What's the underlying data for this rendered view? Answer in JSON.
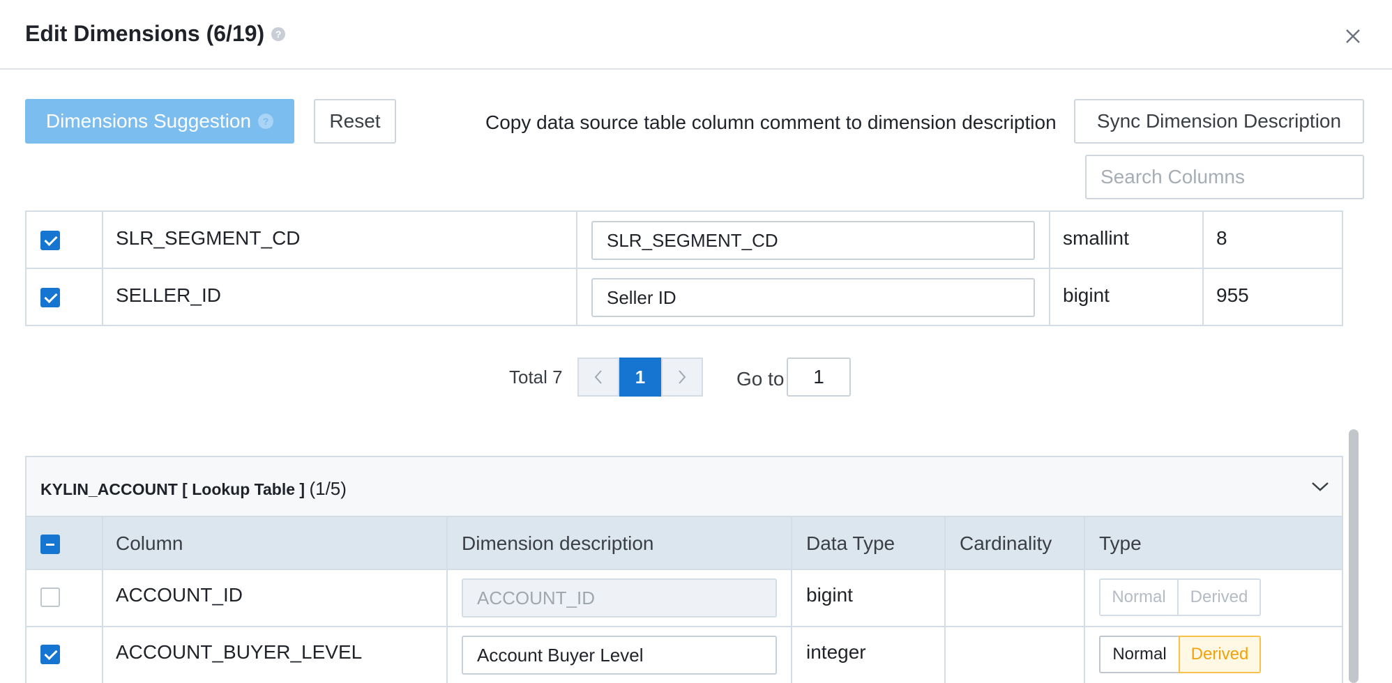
{
  "dialog": {
    "title": "Edit Dimensions (6/19)",
    "help_glyph": "?",
    "close_glyph": "×"
  },
  "toolbar": {
    "suggest_label": "Dimensions Suggestion",
    "reset_label": "Reset",
    "copy_text": "Copy data source table column comment to dimension description",
    "sync_label": "Sync Dimension Description",
    "search_placeholder": "Search Columns"
  },
  "fact_table": {
    "rows": [
      {
        "checked": true,
        "column": "SLR_SEGMENT_CD",
        "description": "SLR_SEGMENT_CD",
        "data_type": "smallint",
        "cardinality": "8"
      },
      {
        "checked": true,
        "column": "SELLER_ID",
        "description": "Seller ID",
        "data_type": "bigint",
        "cardinality": "955"
      }
    ],
    "pager": {
      "total_label": "Total 7",
      "current_page": "1",
      "goto_label": "Go to",
      "goto_value": "1"
    }
  },
  "lookup_table": {
    "name": "KYLIN_ACCOUNT [ Lookup Table ]",
    "count": "(1/5)",
    "headers": {
      "column": "Column",
      "description": "Dimension description",
      "data_type": "Data Type",
      "cardinality": "Cardinality",
      "type": "Type"
    },
    "rows": [
      {
        "checked": false,
        "column": "ACCOUNT_ID",
        "description": "ACCOUNT_ID",
        "data_type": "bigint",
        "cardinality": "",
        "type_normal": "Normal",
        "type_derived": "Derived",
        "enabled": false
      },
      {
        "checked": true,
        "column": "ACCOUNT_BUYER_LEVEL",
        "description": "Account Buyer Level",
        "data_type": "integer",
        "cardinality": "",
        "type_normal": "Normal",
        "type_derived": "Derived",
        "enabled": true,
        "selected_type": "Derived"
      }
    ]
  },
  "colors": {
    "primary": "#1675d1",
    "suggest_button": "#7cbdf0",
    "derived_accent": "#f2a20c"
  }
}
